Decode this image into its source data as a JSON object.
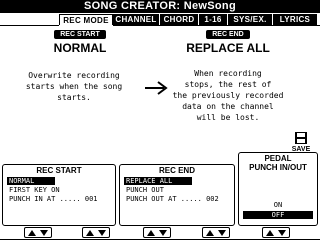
{
  "window": {
    "title": "SONG CREATOR: NewSong"
  },
  "tabs": [
    {
      "label": "REC MODE",
      "active": true
    },
    {
      "label": "CHANNEL",
      "active": false
    },
    {
      "label": "CHORD",
      "active": false
    },
    {
      "label": "1-16",
      "active": false
    },
    {
      "label": "SYS/EX.",
      "active": false
    },
    {
      "label": "LYRICS",
      "active": false
    }
  ],
  "rec_start": {
    "badge": "REC START",
    "mode": "NORMAL",
    "description": [
      "Overwrite recording",
      "starts when the song",
      "starts."
    ]
  },
  "rec_end": {
    "badge": "REC END",
    "mode": "REPLACE ALL",
    "description": [
      "When recording",
      "stops, the rest of",
      "the previously recorded",
      "data on the channel",
      "will be lost."
    ]
  },
  "save_button": {
    "label": "SAVE",
    "icon": "floppy-disk-icon"
  },
  "panels": {
    "rec_start": {
      "title": "REC START",
      "options": [
        "NORMAL",
        "FIRST KEY ON",
        "PUNCH IN AT ..... 001"
      ],
      "selected": 0
    },
    "rec_end": {
      "title": "REC END",
      "options": [
        "REPLACE ALL",
        "PUNCH OUT",
        "PUNCH OUT AT ..... 002"
      ],
      "selected": 0
    },
    "pedal": {
      "title_line1": "PEDAL",
      "title_line2": "PUNCH IN/OUT",
      "options": [
        "ON",
        "OFF"
      ],
      "selected": 1
    }
  }
}
